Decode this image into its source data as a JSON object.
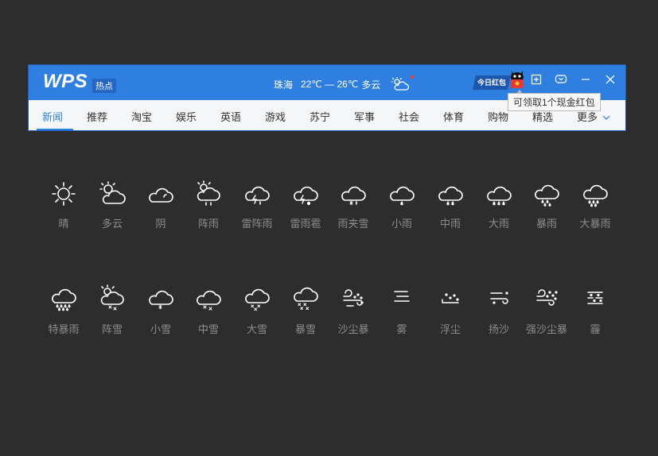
{
  "app": {
    "logo": "WPS",
    "logo_tag": "热点"
  },
  "weather": {
    "city": "珠海",
    "temp": "22℃ — 26℃",
    "condition": "多云",
    "icon": "partly-cloudy-icon"
  },
  "promo": {
    "banner": "今日红包",
    "tooltip": "可领取1个现金红包"
  },
  "nav": {
    "items": [
      "新闻",
      "推荐",
      "淘宝",
      "娱乐",
      "英语",
      "游戏",
      "苏宁",
      "军事",
      "社会",
      "体育",
      "购物",
      "精选",
      "更多"
    ],
    "active_index": 0
  },
  "weather_icons": {
    "row1": [
      "晴",
      "多云",
      "阴",
      "阵雨",
      "雷阵雨",
      "雷雨雹",
      "雨夹雪",
      "小雨",
      "中雨",
      "大雨",
      "暴雨",
      "大暴雨"
    ],
    "row2": [
      "特暴雨",
      "阵雪",
      "小雪",
      "中雪",
      "大雪",
      "暴雪",
      "沙尘暴",
      "雾",
      "浮尘",
      "扬沙",
      "强沙尘暴",
      "霾"
    ]
  },
  "colors": {
    "titlebar": "#2f7fe0",
    "background": "#2d2d2d",
    "label": "#8d8d8d"
  }
}
